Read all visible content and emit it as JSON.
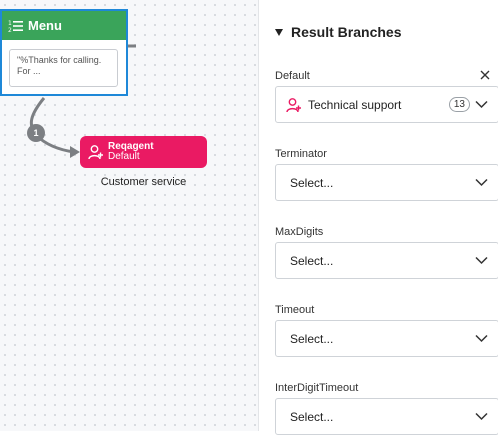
{
  "canvas": {
    "menu_node": {
      "title": "Menu",
      "icon": "numbered-list-icon",
      "preview_text": "\"%Thanks for calling. For ...",
      "header_color": "#3aa45a",
      "border_color": "#1e88d8"
    },
    "connector_badge": "1",
    "reqagent_node": {
      "title": "Reqagent",
      "subtitle": "Default",
      "caption": "Customer service",
      "icon": "person-add-icon",
      "color": "#ea1a63"
    }
  },
  "panel": {
    "title": "Result Branches",
    "fields": {
      "default": {
        "label": "Default",
        "value": "Technical support",
        "count": "13",
        "icon": "person-add-icon"
      },
      "terminator": {
        "label": "Terminator",
        "value": "Select..."
      },
      "maxdigits": {
        "label": "MaxDigits",
        "value": "Select..."
      },
      "timeout": {
        "label": "Timeout",
        "value": "Select..."
      },
      "interdigittimeout": {
        "label": "InterDigitTimeout",
        "value": "Select..."
      }
    }
  }
}
